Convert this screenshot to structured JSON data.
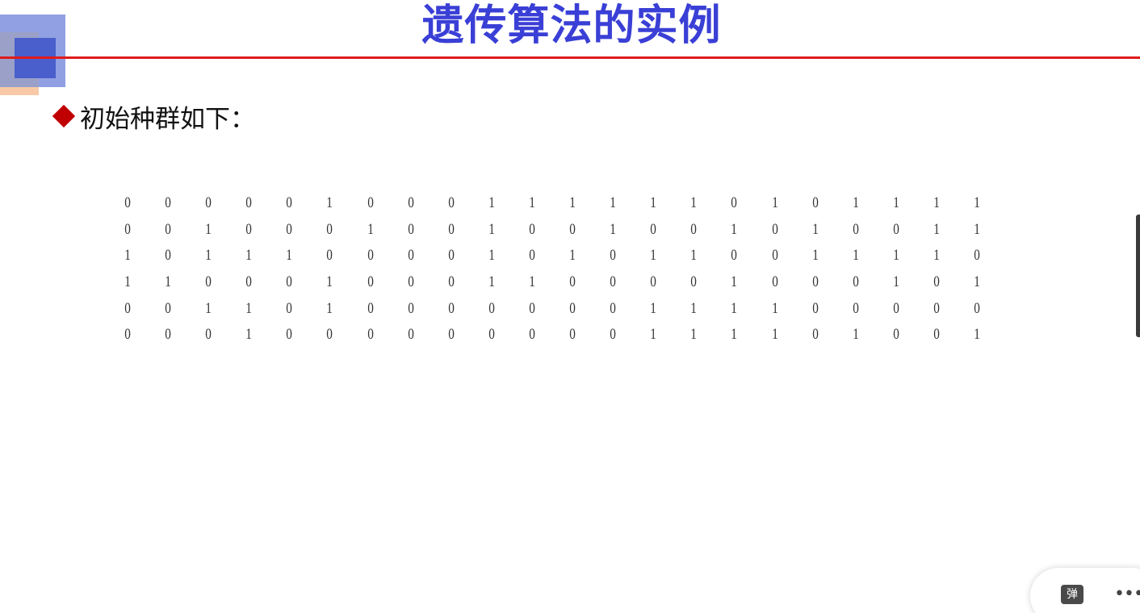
{
  "slide": {
    "title": "遗传算法的实例",
    "bullet_text": "初始种群如下：",
    "population_rows": [
      [
        "0",
        "0",
        "0",
        "0",
        "0",
        "1",
        "0",
        "0",
        "0",
        "1",
        "1",
        "1",
        "1",
        "1",
        "1",
        "0",
        "1",
        "0",
        "1",
        "1",
        "1",
        "1"
      ],
      [
        "0",
        "0",
        "1",
        "0",
        "0",
        "0",
        "1",
        "0",
        "0",
        "1",
        "0",
        "0",
        "1",
        "0",
        "0",
        "1",
        "0",
        "1",
        "0",
        "0",
        "1",
        "1"
      ],
      [
        "1",
        "0",
        "1",
        "1",
        "1",
        "0",
        "0",
        "0",
        "0",
        "1",
        "0",
        "1",
        "0",
        "1",
        "1",
        "0",
        "0",
        "1",
        "1",
        "1",
        "1",
        "0"
      ],
      [
        "1",
        "1",
        "0",
        "0",
        "0",
        "1",
        "0",
        "0",
        "0",
        "1",
        "1",
        "0",
        "0",
        "0",
        "0",
        "1",
        "0",
        "0",
        "0",
        "1",
        "0",
        "1"
      ],
      [
        "0",
        "0",
        "1",
        "1",
        "0",
        "1",
        "0",
        "0",
        "0",
        "0",
        "0",
        "0",
        "0",
        "1",
        "1",
        "1",
        "1",
        "0",
        "0",
        "0",
        "0",
        "0"
      ],
      [
        "0",
        "0",
        "0",
        "1",
        "0",
        "0",
        "0",
        "0",
        "0",
        "0",
        "0",
        "0",
        "0",
        "1",
        "1",
        "1",
        "1",
        "0",
        "1",
        "0",
        "0",
        "1"
      ]
    ]
  },
  "player_controls": {
    "danmu_label": "弹",
    "more_icon": "more-horizontal-icon",
    "more_glyph": "•••"
  },
  "colors": {
    "title": "#3a3fd6",
    "rule_line": "#e01b1b",
    "bullet_diamond": "#c00000"
  }
}
